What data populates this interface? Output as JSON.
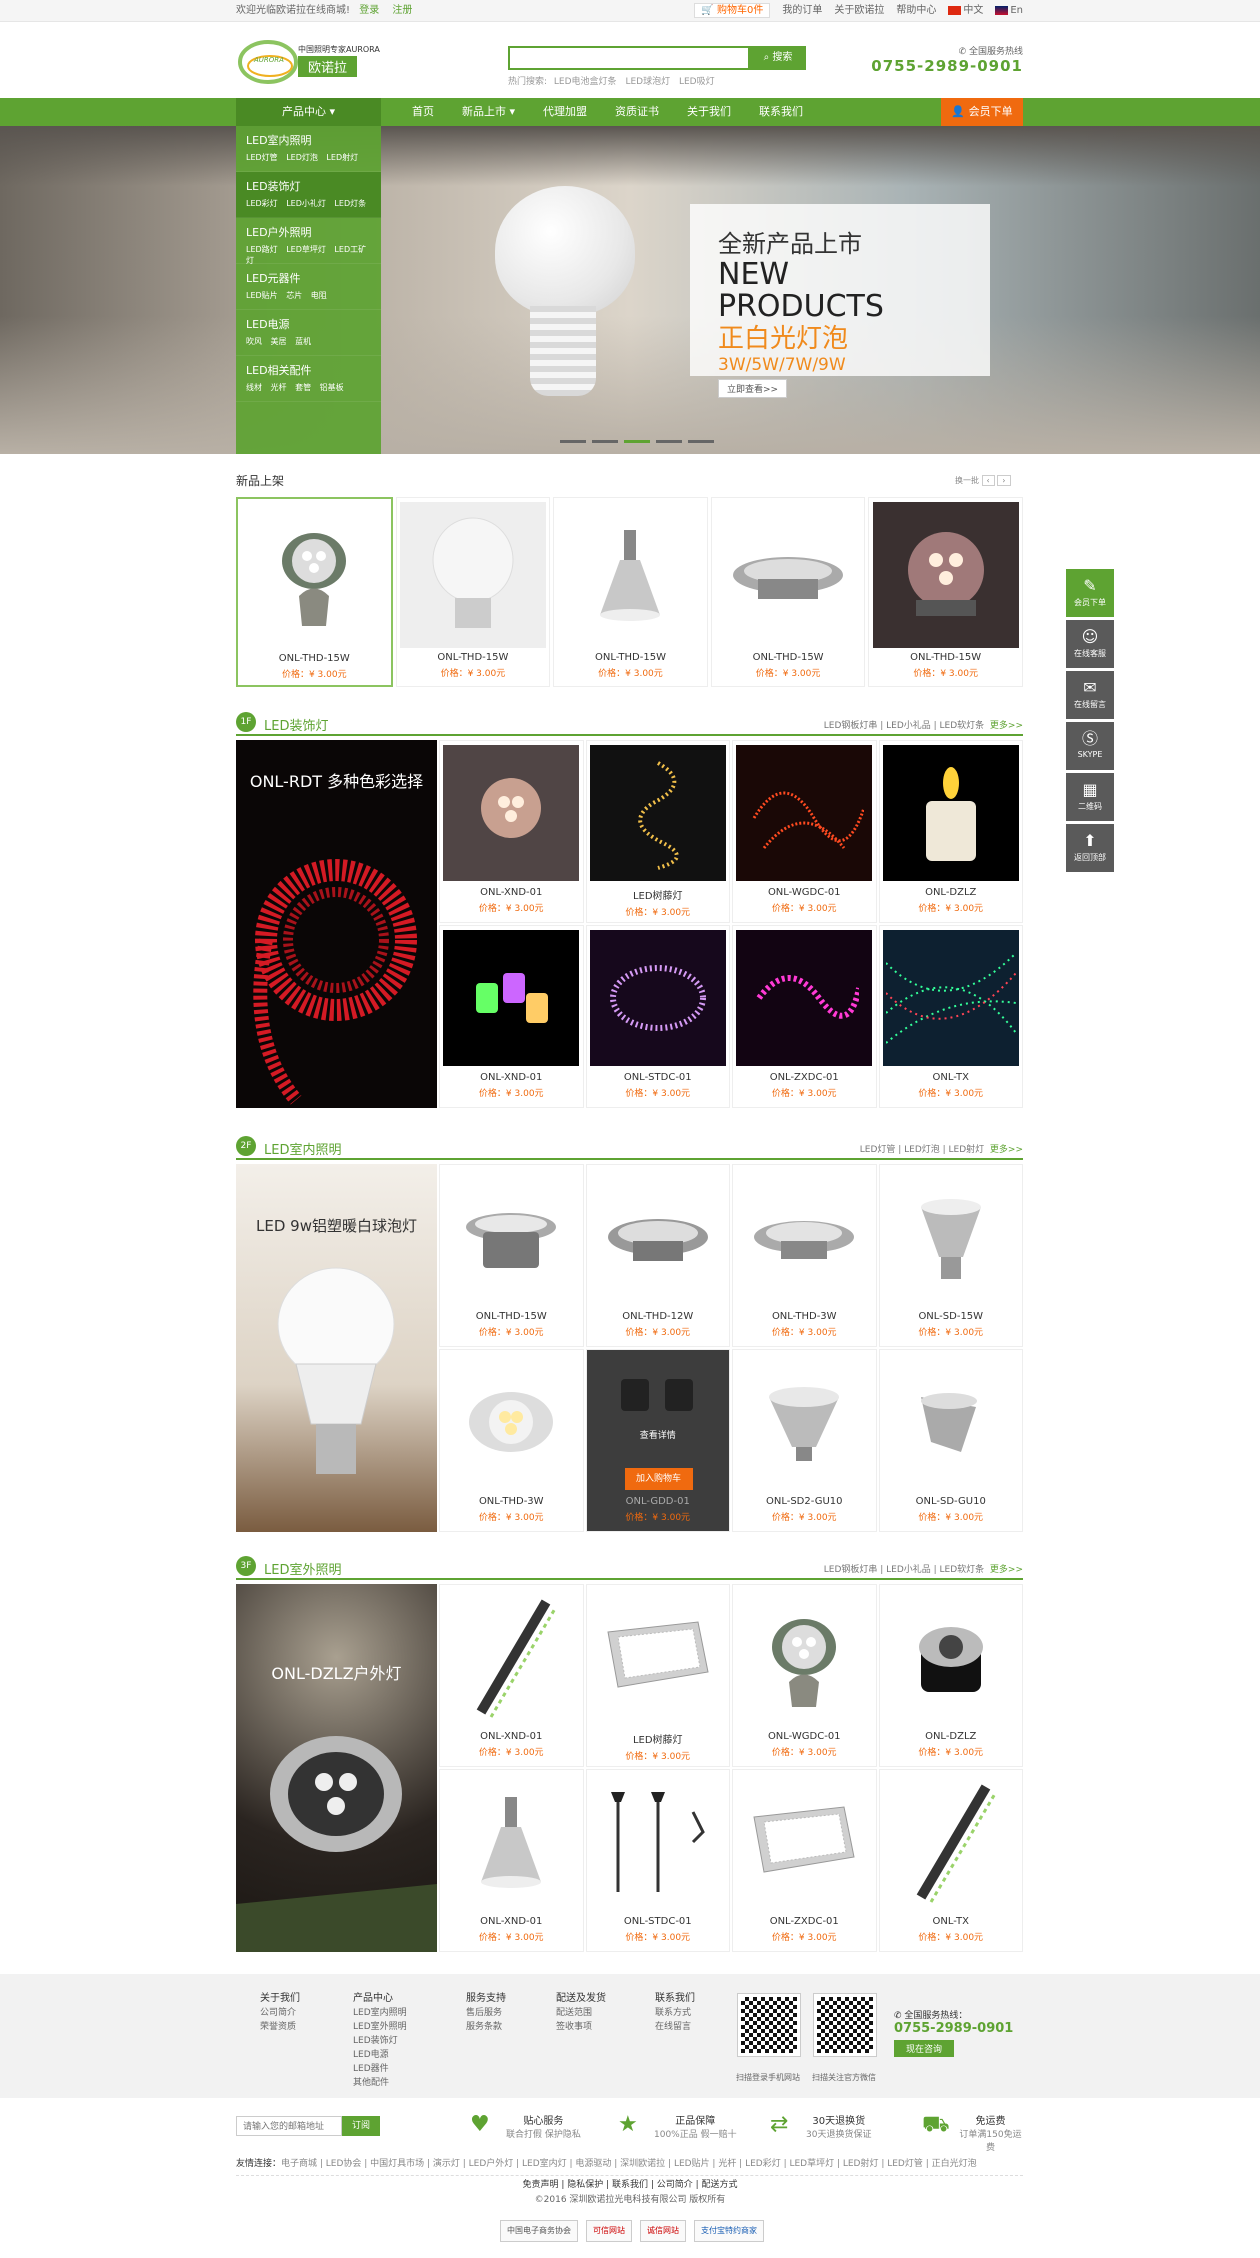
{
  "topbar": {
    "welcome": "欢迎光临欧诺拉在线商城!",
    "login": "登录",
    "register": "注册",
    "cart": "购物车0件",
    "orders": "我的订单",
    "about": "关于欧诺拉",
    "help": "帮助中心",
    "lang_cn": "中文",
    "lang_en": "En"
  },
  "header": {
    "logo_tag": "中国照明专家AURORA",
    "logo_name": "欧诺拉",
    "logo_mark": "AURORA",
    "search_placeholder": "",
    "search_btn": "搜索",
    "hot_label": "热门搜索:",
    "hot": [
      "LED电池盒灯条",
      "LED球泡灯",
      "LED吸灯"
    ],
    "hotline_label": "全国服务热线",
    "hotline": "0755-2989-0901"
  },
  "nav": {
    "category": "产品中心",
    "items": [
      "首页",
      "新品上市",
      "代理加盟",
      "资质证书",
      "关于我们",
      "联系我们"
    ],
    "order": "会员下单"
  },
  "catmenu": [
    {
      "t": "LED室内照明",
      "s": "LED灯管 LED灯泡 LED射灯"
    },
    {
      "t": "LED装饰灯",
      "s": "LED彩灯 LED小礼灯 LED灯条"
    },
    {
      "t": "LED户外照明",
      "s": "LED路灯 LED草坪灯 LED工矿灯"
    },
    {
      "t": "LED元器件",
      "s": "LED贴片 芯片 电阻"
    },
    {
      "t": "LED电源",
      "s": "吹风 美居 蓝机"
    },
    {
      "t": "LED相关配件",
      "s": "线材 光杆 套管 铝基板"
    }
  ],
  "banner": {
    "l1": "全新产品上市",
    "l2": "NEW PRODUCTS",
    "l3": "正白光灯泡",
    "l4": "3W/5W/7W/9W",
    "more": "立即查看>>"
  },
  "newsec": {
    "title": "新品上架",
    "change": "换一批",
    "items": [
      {
        "n": "ONL-THD-15W",
        "p": "价格：¥ 3.00元"
      },
      {
        "n": "ONL-THD-15W",
        "p": "价格：¥ 3.00元"
      },
      {
        "n": "ONL-THD-15W",
        "p": "价格：¥ 3.00元"
      },
      {
        "n": "ONL-THD-15W",
        "p": "价格：¥ 3.00元"
      },
      {
        "n": "ONL-THD-15W",
        "p": "价格：¥ 3.00元"
      }
    ]
  },
  "floors": [
    {
      "num": "1F",
      "name": "LED装饰灯",
      "links": "LED钢板灯串 | LED小礼品 | LED软灯条",
      "more": "更多>>",
      "cap": "ONL-RDT 多种色彩选择",
      "items": [
        {
          "n": "ONL-XND-01",
          "p": "价格：¥ 3.00元"
        },
        {
          "n": "LED树藤灯",
          "p": "价格：¥ 3.00元"
        },
        {
          "n": "ONL-WGDC-01",
          "p": "价格：¥ 3.00元"
        },
        {
          "n": "ONL-DZLZ",
          "p": "价格：¥ 3.00元"
        },
        {
          "n": "ONL-XND-01",
          "p": "价格：¥ 3.00元"
        },
        {
          "n": "ONL-STDC-01",
          "p": "价格：¥ 3.00元"
        },
        {
          "n": "ONL-ZXDC-01",
          "p": "价格：¥ 3.00元"
        },
        {
          "n": "ONL-TX",
          "p": "价格：¥ 3.00元"
        }
      ]
    },
    {
      "num": "2F",
      "name": "LED室内照明",
      "links": "LED灯管 | LED灯泡 | LED射灯",
      "more": "更多>>",
      "cap": "LED 9w铝塑暖白球泡灯",
      "items": [
        {
          "n": "ONL-THD-15W",
          "p": "价格：¥ 3.00元"
        },
        {
          "n": "ONL-THD-12W",
          "p": "价格：¥ 3.00元"
        },
        {
          "n": "ONL-THD-3W",
          "p": "价格：¥ 3.00元"
        },
        {
          "n": "ONL-SD-15W",
          "p": "价格：¥ 3.00元"
        },
        {
          "n": "ONL-THD-3W",
          "p": "价格：¥ 3.00元"
        },
        {
          "n": "ONL-GDD-01",
          "p": "价格：¥ 3.00元"
        },
        {
          "n": "ONL-SD2-GU10",
          "p": "价格：¥ 3.00元"
        },
        {
          "n": "ONL-SD-GU10",
          "p": "价格：¥ 3.00元"
        }
      ],
      "detail": "查看详情",
      "addcart": "加入购物车"
    },
    {
      "num": "3F",
      "name": "LED室外照明",
      "links": "LED钢板灯串 | LED小礼品 | LED软灯条",
      "more": "更多>>",
      "cap": "ONL-DZLZ户外灯",
      "items": [
        {
          "n": "ONL-XND-01",
          "p": "价格：¥ 3.00元"
        },
        {
          "n": "LED树藤灯",
          "p": "价格：¥ 3.00元"
        },
        {
          "n": "ONL-WGDC-01",
          "p": "价格：¥ 3.00元"
        },
        {
          "n": "ONL-DZLZ",
          "p": "价格：¥ 3.00元"
        },
        {
          "n": "ONL-XND-01",
          "p": "价格：¥ 3.00元"
        },
        {
          "n": "ONL-STDC-01",
          "p": "价格：¥ 3.00元"
        },
        {
          "n": "ONL-ZXDC-01",
          "p": "价格：¥ 3.00元"
        },
        {
          "n": "ONL-TX",
          "p": "价格：¥ 3.00元"
        }
      ]
    }
  ],
  "side": [
    "会员下单",
    "在线客服",
    "在线留言",
    "SKYPE",
    "二维码",
    "返回顶部"
  ],
  "footer": {
    "cols": [
      {
        "h": "关于我们",
        "i": [
          "公司简介",
          "荣誉资质"
        ]
      },
      {
        "h": "产品中心",
        "i": [
          "LED室内照明",
          "LED室外照明",
          "LED装饰灯",
          "LED电源",
          "LED器件",
          "其他配件"
        ]
      },
      {
        "h": "服务支持",
        "i": [
          "售后服务",
          "服务条款"
        ]
      },
      {
        "h": "配送及发货",
        "i": [
          "配送范围",
          "签收事项"
        ]
      },
      {
        "h": "联系我们",
        "i": [
          "联系方式",
          "在线留言"
        ]
      }
    ],
    "qr1": "扫描登录手机网站",
    "qr2": "扫描关注官方微信",
    "hot_label": "全国服务热线：",
    "hotline": "0755-2989-0901",
    "consult": "现在咨询"
  },
  "service": {
    "sub_ph": "请输入您的邮箱地址",
    "sub_btn": "订阅",
    "items": [
      {
        "t": "贴心服务",
        "d": "联合打假 保护隐私"
      },
      {
        "t": "正品保障",
        "d": "100%正品 假一赔十"
      },
      {
        "t": "30天退换货",
        "d": "30天退换货保证"
      },
      {
        "t": "免运费",
        "d": "订单满150免运费"
      }
    ]
  },
  "links": {
    "label": "友情连接：",
    "items": "电子商城 | LED协会 | 中国灯具市场 | 演示灯 | LED户外灯 | LED室内灯 | 电源驱动 | 深圳欧诺拉 | LED贴片 | 光杆 | LED彩灯 | LED草坪灯 | LED射灯 | LED灯管 | 正白光灯泡"
  },
  "bottom": {
    "l1": "免责声明 | 隐私保护 | 联系我们 | 公司简介 | 配送方式",
    "l2": "©2016 深圳欧诺拉光电科技有限公司 版权所有"
  },
  "badges": [
    "中国电子商务协会",
    "可信网站",
    "诚信网站",
    "支付宝特约商家"
  ]
}
